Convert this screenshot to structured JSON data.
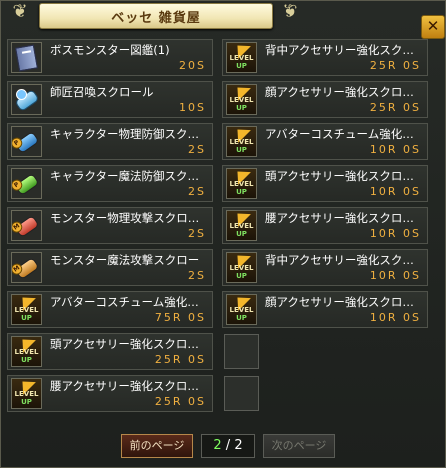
{
  "window": {
    "title": "ベッセ 雑貨屋",
    "close_label": "✕"
  },
  "left_items": [
    {
      "name": "ボスモンスター図鑑(1)",
      "price": "20S",
      "icon": "book-icon"
    },
    {
      "name": "師匠召喚スクロール",
      "price": "10S",
      "icon": "scroll-summon-icon"
    },
    {
      "name": "キャラクター物理防御スク…",
      "price": "2S",
      "icon": "scroll-phys-def-icon"
    },
    {
      "name": "キャラクター魔法防御スク…",
      "price": "2S",
      "icon": "scroll-mag-def-icon"
    },
    {
      "name": "モンスター物理攻撃スクロ…",
      "price": "2S",
      "icon": "scroll-phys-atk-icon"
    },
    {
      "name": "モンスター魔法攻撃スクロー",
      "price": "2S",
      "icon": "scroll-mag-atk-icon"
    },
    {
      "name": "アバターコスチューム強化…",
      "price": "75R 0S",
      "icon": "level-up-icon"
    },
    {
      "name": "頭アクセサリー強化スクロ…",
      "price": "25R 0S",
      "icon": "level-up-icon"
    },
    {
      "name": "腰アクセサリー強化スクロ…",
      "price": "25R 0S",
      "icon": "level-up-icon"
    }
  ],
  "right_items": [
    {
      "name": "背中アクセサリー強化スク…",
      "price": "25R 0S",
      "icon": "level-up-icon"
    },
    {
      "name": "顔アクセサリー強化スクロ…",
      "price": "25R 0S",
      "icon": "level-up-icon"
    },
    {
      "name": "アバターコスチューム強化…",
      "price": "10R 0S",
      "icon": "level-up-icon"
    },
    {
      "name": "頭アクセサリー強化スクロ…",
      "price": "10R 0S",
      "icon": "level-up-icon"
    },
    {
      "name": "腰アクセサリー強化スクロ…",
      "price": "10R 0S",
      "icon": "level-up-icon"
    },
    {
      "name": "背中アクセサリー強化スク…",
      "price": "10R 0S",
      "icon": "level-up-icon"
    },
    {
      "name": "顔アクセサリー強化スクロ…",
      "price": "10R 0S",
      "icon": "level-up-icon"
    }
  ],
  "level_icon": {
    "top": "LEVEL",
    "bottom": "UP"
  },
  "pager": {
    "prev_label": "前のページ",
    "current": "2",
    "separator": "/",
    "total": "2",
    "next_label": "次のページ"
  },
  "colors": {
    "price": "#f0b040",
    "page_current": "#80ff60",
    "title_bg": "#f1e6b4"
  }
}
